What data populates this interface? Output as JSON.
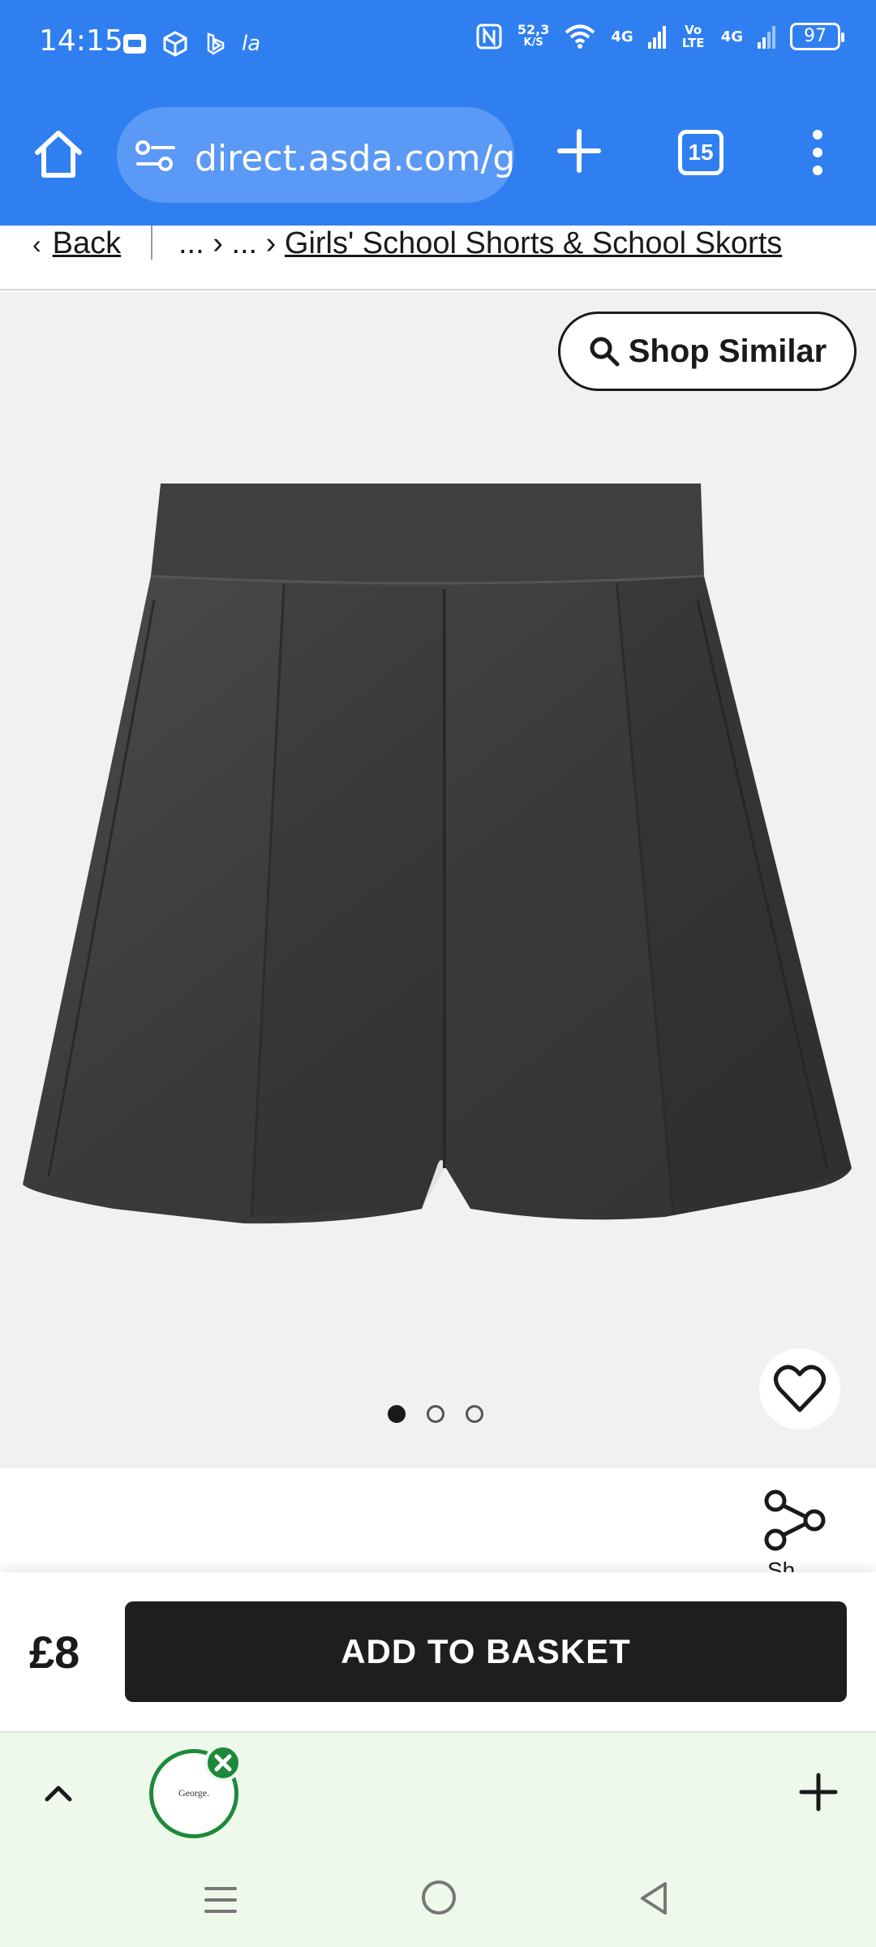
{
  "status_bar": {
    "time": "14:15",
    "left_icons": [
      "message-icon",
      "cube-icon",
      "bing-icon",
      "la-icon"
    ],
    "la_text": "la",
    "net_speed_value": "52,3",
    "net_speed_unit": "K/S",
    "network_4g_1": "4G",
    "volte": "Vo LTE",
    "network_4g_2": "4G",
    "battery": "97"
  },
  "browser": {
    "url": "direct.asda.com/g",
    "tab_count": "15"
  },
  "breadcrumb": {
    "back": "Back",
    "trail": "... › ... ›",
    "current": "Girls' School Shorts & School Skorts"
  },
  "product": {
    "shop_similar": "Shop Similar",
    "image_count": 3,
    "active_image": 1,
    "share_label": "Sh"
  },
  "basket": {
    "price": "£8",
    "add_button": "ADD TO BASKET"
  },
  "tab_group": {
    "tab_label": "George."
  },
  "colors": {
    "browser_blue": "#2f7ff1",
    "button_dark": "#1e1e1e",
    "group_green": "#1d8a3a",
    "group_bg": "#eef9ec"
  }
}
